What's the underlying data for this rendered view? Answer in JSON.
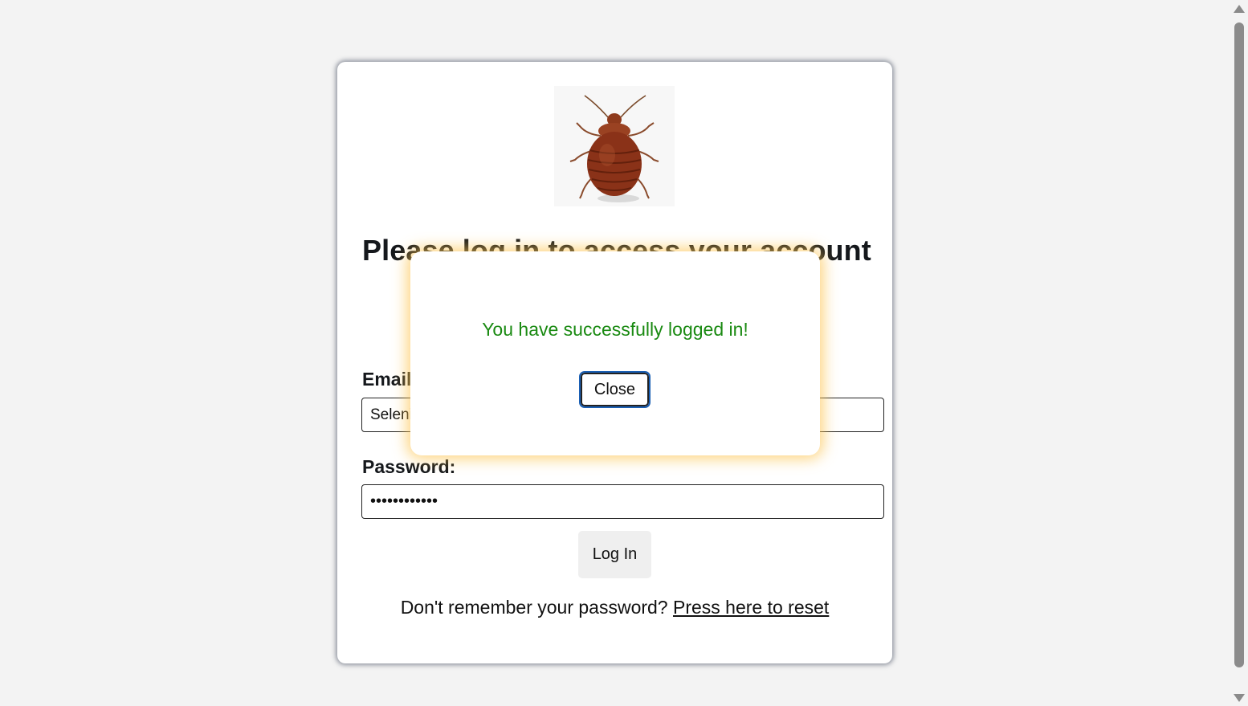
{
  "login": {
    "logo_icon": "bedbug-icon",
    "heading": "Please log in to access your account",
    "email_label": "Email:",
    "email_value": "Selenium@test.com",
    "password_label": "Password:",
    "password_value": "password1234",
    "login_button": "Log In",
    "reset_prompt": "Don't remember your password?",
    "reset_link": "Press here to reset"
  },
  "modal": {
    "message": "You have successfully logged in!",
    "close_button": "Close",
    "message_color": "#1a8a12",
    "glow_color": "#fcc450"
  }
}
